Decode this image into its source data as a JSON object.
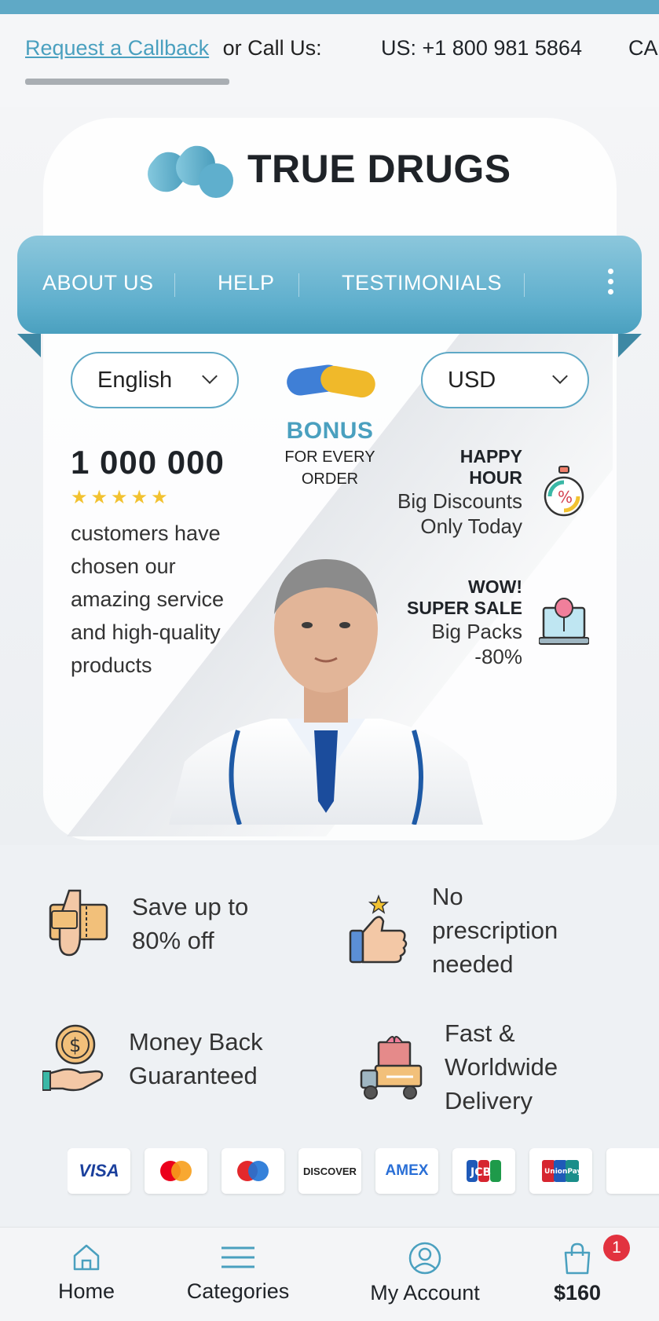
{
  "callbar": {
    "request_callback": "Request a Callback",
    "or_call": "or Call Us:",
    "us_phone": "US: +1 800 981 5864",
    "ca_partial": "CA"
  },
  "brand": {
    "name": "TRUE DRUGS"
  },
  "nav": {
    "items": [
      "ABOUT US",
      "HELP",
      "TESTIMONIALS"
    ],
    "more_icon": "more-vertical-icon"
  },
  "selectors": {
    "language": "English",
    "currency": "USD"
  },
  "bonus": {
    "title": "BONUS",
    "subtitle_line1": "FOR EVERY",
    "subtitle_line2": "ORDER"
  },
  "customers": {
    "count": "1 000 000",
    "stars": "★★★★★",
    "text_lines": [
      "customers have",
      "chosen our",
      "amazing service",
      "and high-quality",
      "products"
    ]
  },
  "promos": {
    "happy_hour": {
      "title_line1": "HAPPY",
      "title_line2": "HOUR",
      "sub_line1": "Big Discounts",
      "sub_line2": "Only Today",
      "icon": "stopwatch-percent-icon"
    },
    "super_sale": {
      "title_line1": "WOW!",
      "title_line2": "SUPER SALE",
      "sub_line1": "Big Packs",
      "sub_line2": "-80%",
      "icon": "laptop-balloon-icon"
    }
  },
  "features": [
    {
      "line1": "Save up to",
      "line2": "80% off",
      "line3": "",
      "icon": "coupon-hand-icon"
    },
    {
      "line1": "No",
      "line2": "prescription",
      "line3": "needed",
      "icon": "thumbs-up-icon"
    },
    {
      "line1": "Money Back",
      "line2": "Guaranteed",
      "line3": "",
      "icon": "coin-hand-icon"
    },
    {
      "line1": "Fast &",
      "line2": "Worldwide",
      "line3": "Delivery",
      "icon": "delivery-truck-icon"
    }
  ],
  "payments": [
    "VISA",
    "Mastercard",
    "Maestro",
    "DISCOVER",
    "AMEX",
    "JCB",
    "UnionPay"
  ],
  "bottom_nav": {
    "home": "Home",
    "categories": "Categories",
    "account": "My Account",
    "cart_total": "$160",
    "cart_badge": "1"
  },
  "colors": {
    "accent": "#4aa0bf",
    "accent_light": "#8cc7dc",
    "badge": "#e2323f",
    "star": "#f2c230"
  }
}
